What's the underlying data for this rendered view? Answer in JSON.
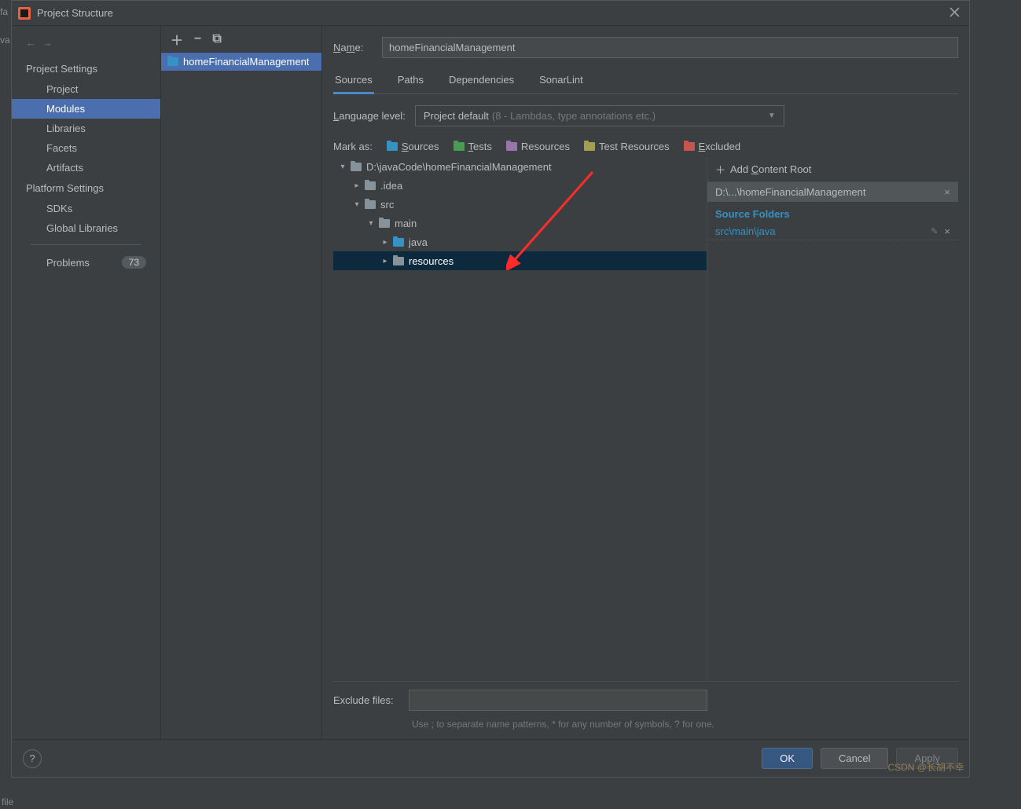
{
  "title": "Project Structure",
  "sidebar": {
    "sections": {
      "project_settings": "Project Settings",
      "platform_settings": "Platform Settings"
    },
    "items": {
      "project": "Project",
      "modules": "Modules",
      "libraries": "Libraries",
      "facets": "Facets",
      "artifacts": "Artifacts",
      "sdks": "SDKs",
      "global_libraries": "Global Libraries",
      "problems": "Problems"
    },
    "problems_count": "73"
  },
  "module_list": {
    "item0": "homeFinancialManagement"
  },
  "name_field": {
    "label": "Name:",
    "value": "homeFinancialManagement"
  },
  "tabs": {
    "sources": "Sources",
    "paths": "Paths",
    "dependencies": "Dependencies",
    "sonarlint": "SonarLint"
  },
  "language_level": {
    "label": "Language level:",
    "value": "Project default",
    "hint": "(8 - Lambdas, type annotations etc.)"
  },
  "mark_as": {
    "label": "Mark as:",
    "sources": "Sources",
    "tests": "Tests",
    "resources": "Resources",
    "test_resources": "Test Resources",
    "excluded": "Excluded"
  },
  "tree": {
    "root": "D:\\javaCode\\homeFinancialManagement",
    "idea": ".idea",
    "src": "src",
    "main": "main",
    "java": "java",
    "resources": "resources"
  },
  "right_panel": {
    "add_content_root": "Add Content Root",
    "content_root_path": "D:\\...\\homeFinancialManagement",
    "source_folders_header": "Source Folders",
    "source_folder_0": "src\\main\\java"
  },
  "exclude": {
    "label": "Exclude files:",
    "hint": "Use ; to separate name patterns, * for any number of symbols, ? for one."
  },
  "footer": {
    "ok": "OK",
    "cancel": "Cancel",
    "apply": "Apply"
  },
  "watermark": "CSDN @长胡不幸",
  "truncated_bottom": "file"
}
